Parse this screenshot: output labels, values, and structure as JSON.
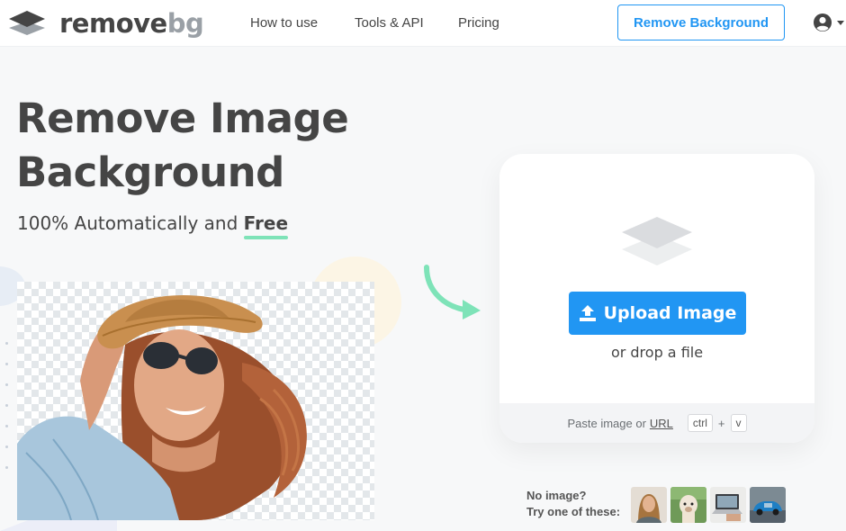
{
  "header": {
    "logo_remove": "remove",
    "logo_bg": "bg",
    "nav": [
      "How to use",
      "Tools & API",
      "Pricing"
    ],
    "cta_label": "Remove Background",
    "account_icon": "user-circle-icon"
  },
  "hero": {
    "title_line1": "Remove Image",
    "title_line2": "Background",
    "subtitle_prefix": "100% Automatically and",
    "subtitle_emphasis": "Free"
  },
  "upload": {
    "button_label": "Upload Image",
    "drop_text": "or drop a file",
    "paste_text": "Paste image or",
    "url_link": "URL",
    "key_ctrl": "ctrl",
    "key_plus": "+",
    "key_v": "v"
  },
  "samples": {
    "line1": "No image?",
    "line2": "Try one of these:",
    "items": [
      "sample-woman",
      "sample-alpaca",
      "sample-laptop",
      "sample-car"
    ]
  },
  "colors": {
    "accent": "#2196f3",
    "text": "#454545",
    "highlight": "#7ee3b8"
  }
}
